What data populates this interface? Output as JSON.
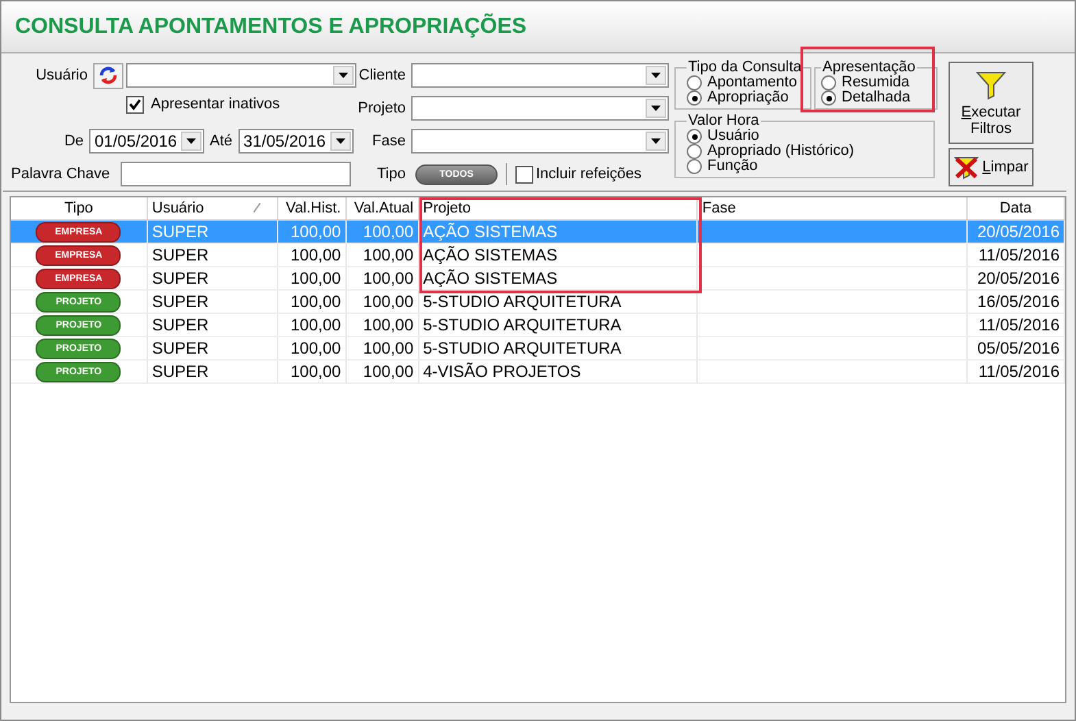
{
  "title": "CONSULTA APONTAMENTOS E APROPRIAÇÕES",
  "filters": {
    "usuario": {
      "label": "Usuário"
    },
    "inativos": {
      "label": "Apresentar inativos",
      "checked": true
    },
    "de": {
      "label": "De",
      "value": "01/05/2016"
    },
    "ate": {
      "label": "Até",
      "value": "31/05/2016"
    },
    "palavra_chave": {
      "label": "Palavra Chave"
    },
    "cliente": {
      "label": "Cliente"
    },
    "projeto": {
      "label": "Projeto"
    },
    "fase": {
      "label": "Fase"
    },
    "tipo": {
      "label": "Tipo",
      "value": "TODOS"
    },
    "refeicoes": {
      "label": "Incluir refeições",
      "checked": false
    }
  },
  "tipo_consulta": {
    "title": "Tipo da Consulta",
    "options": [
      {
        "label": "Apontamento",
        "selected": false
      },
      {
        "label": "Apropriação",
        "selected": true
      }
    ]
  },
  "apresentacao": {
    "title": "Apresentação",
    "options": [
      {
        "label": "Resumida",
        "selected": false
      },
      {
        "label": "Detalhada",
        "selected": true
      }
    ]
  },
  "valor_hora": {
    "title": "Valor Hora",
    "options": [
      {
        "label": "Usuário",
        "selected": true
      },
      {
        "label": "Apropriado (Histórico)",
        "selected": false
      },
      {
        "label": "Função",
        "selected": false
      }
    ]
  },
  "buttons": {
    "executar": {
      "mnemonic": "E",
      "rest": "xecutar",
      "line2": "Filtros"
    },
    "limpar": {
      "mnemonic": "L",
      "rest": "impar"
    }
  },
  "table": {
    "columns": [
      "Tipo",
      "Usuário",
      "Val.Hist.",
      "Val.Atual",
      "Projeto",
      "Fase",
      "Data"
    ],
    "rows": [
      {
        "tipo": "EMPRESA",
        "color": "#c8282c",
        "usuario": "SUPER",
        "val_hist": "100,00",
        "val_atual": "100,00",
        "projeto": "AÇÃO SISTEMAS",
        "data": "20/05/2016",
        "selected": true
      },
      {
        "tipo": "EMPRESA",
        "color": "#c8282c",
        "usuario": "SUPER",
        "val_hist": "100,00",
        "val_atual": "100,00",
        "projeto": "AÇÃO SISTEMAS",
        "data": "11/05/2016",
        "selected": false
      },
      {
        "tipo": "EMPRESA",
        "color": "#c8282c",
        "usuario": "SUPER",
        "val_hist": "100,00",
        "val_atual": "100,00",
        "projeto": "AÇÃO SISTEMAS",
        "data": "20/05/2016",
        "selected": false
      },
      {
        "tipo": "PROJETO",
        "color": "#3e9a32",
        "usuario": "SUPER",
        "val_hist": "100,00",
        "val_atual": "100,00",
        "projeto": "5-STUDIO ARQUITETURA",
        "data": "16/05/2016",
        "selected": false
      },
      {
        "tipo": "PROJETO",
        "color": "#3e9a32",
        "usuario": "SUPER",
        "val_hist": "100,00",
        "val_atual": "100,00",
        "projeto": "5-STUDIO ARQUITETURA",
        "data": "11/05/2016",
        "selected": false
      },
      {
        "tipo": "PROJETO",
        "color": "#3e9a32",
        "usuario": "SUPER",
        "val_hist": "100,00",
        "val_atual": "100,00",
        "projeto": "5-STUDIO ARQUITETURA",
        "data": "05/05/2016",
        "selected": false
      },
      {
        "tipo": "PROJETO",
        "color": "#3e9a32",
        "usuario": "SUPER",
        "val_hist": "100,00",
        "val_atual": "100,00",
        "projeto": "4-VISÃO PROJETOS",
        "data": "11/05/2016",
        "selected": false
      }
    ]
  }
}
